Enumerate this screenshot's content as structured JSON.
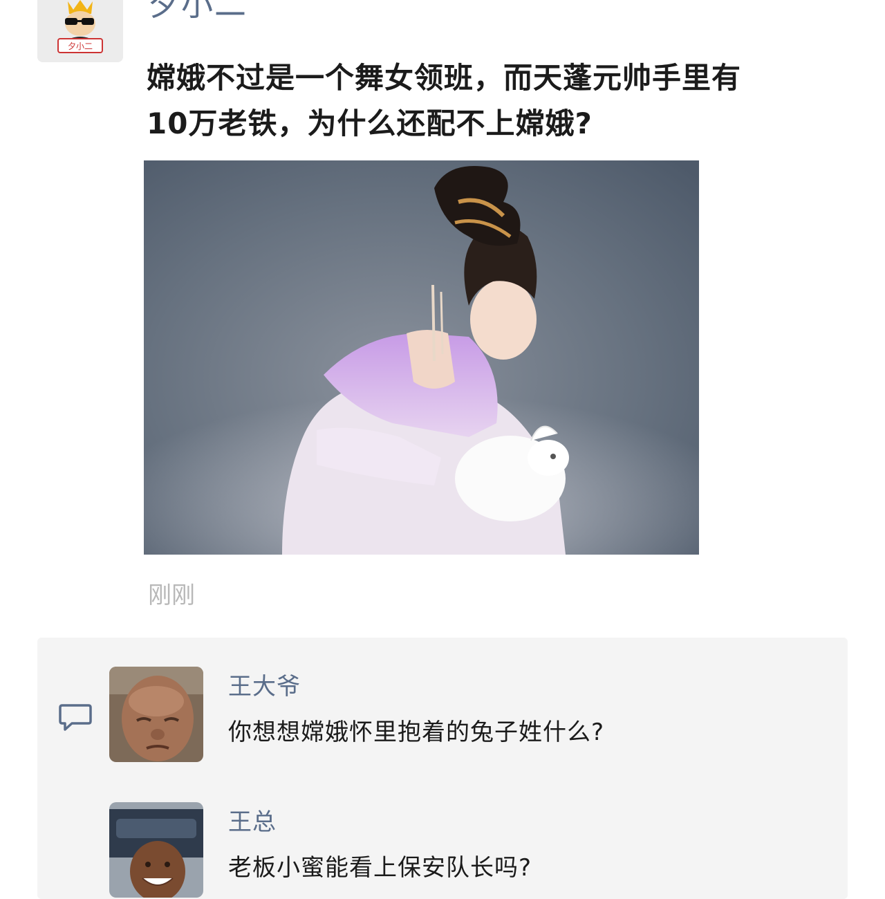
{
  "post": {
    "username": "夕小二",
    "avatar_label": "夕小二",
    "text": "嫦娥不过是一个舞女领班，而天蓬元帅手里有\n10万老铁，为什么还配不上嫦娥?",
    "time": "刚刚"
  },
  "comments": [
    {
      "name": "王大爷",
      "text": "你想想嫦娥怀里抱着的兔子姓什么?"
    },
    {
      "name": "王总",
      "text": "老板小蜜能看上保安队长吗?"
    }
  ],
  "icons": {
    "comment": "comment-bubble-icon"
  },
  "colors": {
    "username": "#5a6d8a",
    "timestamp": "#b8b8b8",
    "comment_panel": "#f4f4f4"
  }
}
